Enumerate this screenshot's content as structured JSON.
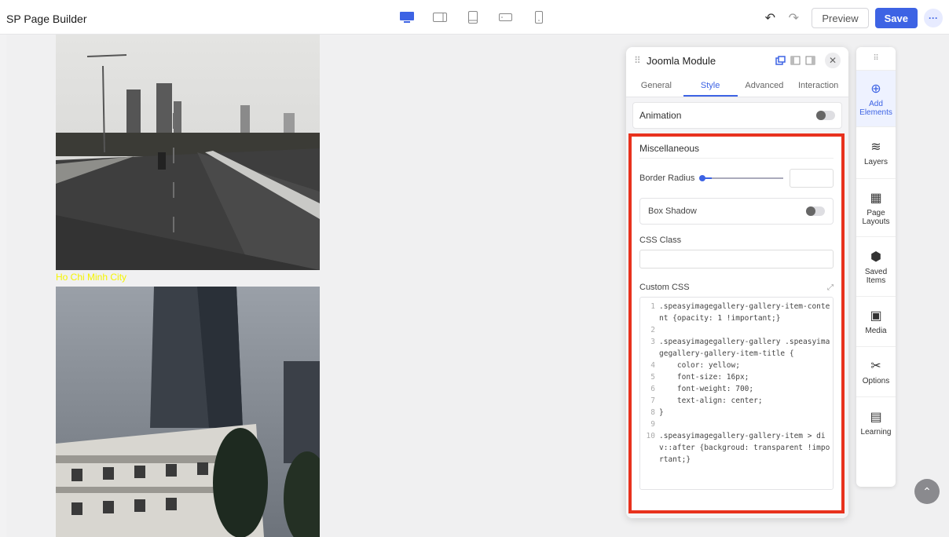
{
  "app": {
    "title": "SP Page Builder"
  },
  "toolbar": {
    "devices": [
      "desktop-icon",
      "tablet-landscape-icon",
      "tablet-icon",
      "mobile-landscape-icon",
      "mobile-icon"
    ],
    "preview_label": "Preview",
    "save_label": "Save",
    "more_label": "···"
  },
  "canvas": {
    "caption": "Ho Chi Minh City"
  },
  "panel": {
    "title": "Joomla Module",
    "tabs": [
      {
        "label": "General",
        "active": false
      },
      {
        "label": "Style",
        "active": true
      },
      {
        "label": "Advanced",
        "active": false
      },
      {
        "label": "Interaction",
        "active": false
      }
    ],
    "animation_label": "Animation",
    "misc": {
      "title": "Miscellaneous",
      "border_radius_label": "Border Radius",
      "border_radius_value": "",
      "box_shadow_label": "Box Shadow",
      "css_class_label": "CSS Class",
      "css_class_value": "",
      "custom_css_label": "Custom CSS"
    },
    "code_lines": [
      {
        "n": "1",
        "text": ".speasyimagegallery-gallery-item-content {opacity: 1 !important;}"
      },
      {
        "n": "2",
        "text": ""
      },
      {
        "n": "3",
        "text": ".speasyimagegallery-gallery .speasyimagegallery-gallery-item-title {"
      },
      {
        "n": "4",
        "text": "    color: yellow;"
      },
      {
        "n": "5",
        "text": "    font-size: 16px;"
      },
      {
        "n": "6",
        "text": "    font-weight: 700;"
      },
      {
        "n": "7",
        "text": "    text-align: center;"
      },
      {
        "n": "8",
        "text": "}"
      },
      {
        "n": "9",
        "text": ""
      },
      {
        "n": "10",
        "text": ".speasyimagegallery-gallery-item > div::after {backgroud: transparent !important;}"
      }
    ]
  },
  "sidebar": {
    "items": [
      {
        "label": "Add Elements",
        "icon": "plus-circle-icon",
        "active": true
      },
      {
        "label": "Layers",
        "icon": "layers-icon",
        "active": false
      },
      {
        "label": "Page Layouts",
        "icon": "layout-icon",
        "active": false
      },
      {
        "label": "Saved Items",
        "icon": "box-icon",
        "active": false
      },
      {
        "label": "Media",
        "icon": "image-icon",
        "active": false
      },
      {
        "label": "Options",
        "icon": "tools-icon",
        "active": false
      },
      {
        "label": "Learning",
        "icon": "book-icon",
        "active": false
      }
    ]
  },
  "colors": {
    "accent": "#3d63e4",
    "highlight_border": "#e8321e",
    "caption": "#f5f500"
  }
}
